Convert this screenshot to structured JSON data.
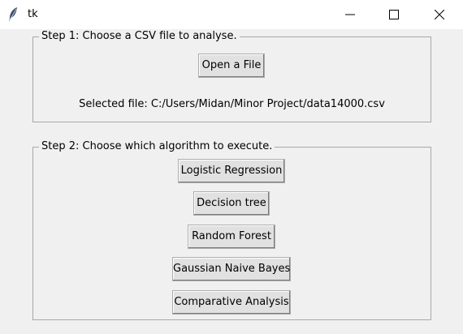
{
  "window": {
    "title": "tk"
  },
  "step1": {
    "legend": "Step 1: Choose a CSV file to analyse.",
    "open_button": "Open a File",
    "selected_file": "Selected file: C:/Users/Midan/Minor Project/data14000.csv"
  },
  "step2": {
    "legend": "Step 2: Choose which algorithm to execute.",
    "buttons": [
      "Logistic Regression",
      "Decision tree",
      "Random Forest",
      "Gaussian Naive Bayes",
      "Comparative Analysis"
    ]
  },
  "icons": {
    "app": "feather-icon",
    "minimize": "minimize-icon",
    "maximize": "maximize-icon",
    "close": "close-icon"
  }
}
